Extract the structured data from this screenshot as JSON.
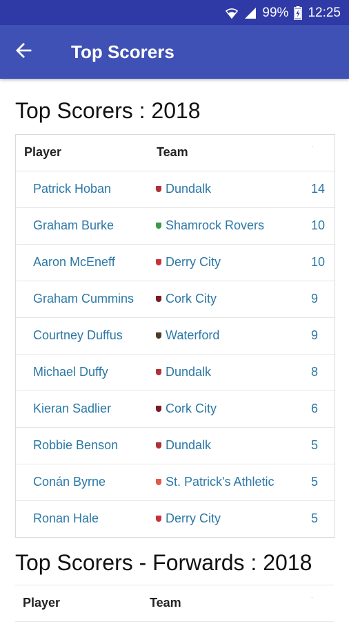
{
  "status_bar": {
    "battery_percent": "99%",
    "time": "12:25",
    "icons": [
      "wifi-icon",
      "signal-icon",
      "battery-charging-icon"
    ]
  },
  "app_bar": {
    "title": "Top Scorers",
    "back_icon": "arrow-back-icon",
    "background_color": "#3f51b5",
    "status_color": "#2f3aa6"
  },
  "section1": {
    "title": "Top Scorers : 2018",
    "columns": {
      "player": "Player",
      "team": "Team",
      "goals": "·"
    },
    "rows": [
      {
        "player": "Patrick Hoban",
        "team": "Dundalk",
        "goals": "14",
        "crest_color": "#b0303a"
      },
      {
        "player": "Graham Burke",
        "team": "Shamrock Rovers",
        "goals": "10",
        "crest_color": "#3a9a4a"
      },
      {
        "player": "Aaron McEneff",
        "team": "Derry City",
        "goals": "10",
        "crest_color": "#c7333a"
      },
      {
        "player": "Graham Cummins",
        "team": "Cork City",
        "goals": "9",
        "crest_color": "#7a1b23"
      },
      {
        "player": "Courtney Duffus",
        "team": "Waterford",
        "goals": "9",
        "crest_color": "#4a3b2a"
      },
      {
        "player": "Michael Duffy",
        "team": "Dundalk",
        "goals": "8",
        "crest_color": "#b0303a"
      },
      {
        "player": "Kieran Sadlier",
        "team": "Cork City",
        "goals": "6",
        "crest_color": "#7a1b23"
      },
      {
        "player": "Robbie Benson",
        "team": "Dundalk",
        "goals": "5",
        "crest_color": "#b0303a"
      },
      {
        "player": "Conán Byrne",
        "team": "St. Patrick's Athletic",
        "goals": "5",
        "crest_color": "#e05a4a"
      },
      {
        "player": "Ronan Hale",
        "team": "Derry City",
        "goals": "5",
        "crest_color": "#c7333a"
      }
    ]
  },
  "section2": {
    "title": "Top Scorers - Forwards : 2018",
    "columns": {
      "player": "Player",
      "team": "Team",
      "goals": "·"
    }
  },
  "colors": {
    "link": "#2b78a6"
  }
}
